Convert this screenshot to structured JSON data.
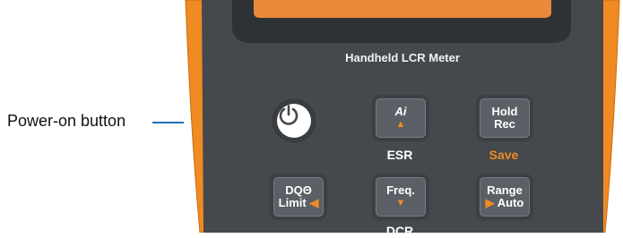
{
  "callout": {
    "label": "Power-on button"
  },
  "device": {
    "title": "Handheld LCR Meter",
    "colors": {
      "body": "#f08a22",
      "panel": "#45494d",
      "key": "#5b6066",
      "accent": "#f08a22",
      "callout_line": "#1f6fb2"
    },
    "power_button": {
      "icon": "power-icon"
    },
    "keys": [
      {
        "id": "ai",
        "line1": "Ai",
        "marker": "▲",
        "sublabel": "ESR"
      },
      {
        "id": "hold",
        "line1": "Hold",
        "line2": "Rec",
        "sublabel": "Save"
      },
      {
        "id": "dqo",
        "line1": "DQΘ",
        "line2": "Limit",
        "marker": "◀"
      },
      {
        "id": "freq",
        "line1": "Freq.",
        "marker": "▼",
        "sublabel": "DCR"
      },
      {
        "id": "range",
        "line1": "Range",
        "line2": "Auto",
        "marker": "▶"
      }
    ]
  }
}
